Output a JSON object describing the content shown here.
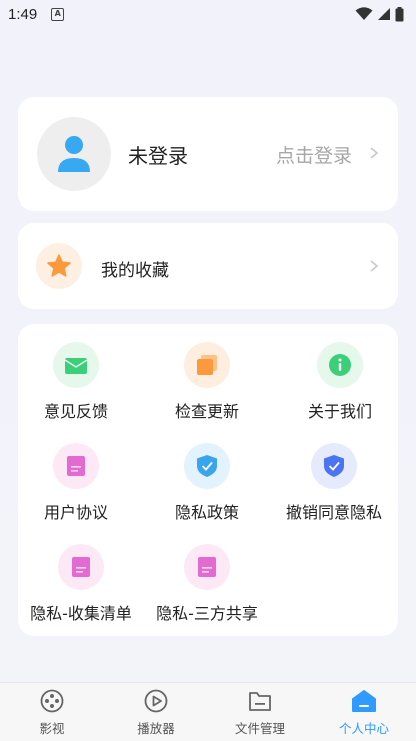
{
  "status_bar": {
    "time": "1:49",
    "notif_letter": "A"
  },
  "login": {
    "name": "未登录",
    "action": "点击登录"
  },
  "favorites": {
    "label": "我的收藏"
  },
  "menu": {
    "items": [
      {
        "label": "意见反馈",
        "icon": "mail-icon",
        "bg": "#e6f8ec",
        "color": "#3ccf79"
      },
      {
        "label": "检查更新",
        "icon": "layers-icon",
        "bg": "#fdeee0",
        "color": "#fb9a3c"
      },
      {
        "label": "关于我们",
        "icon": "info-icon",
        "bg": "#e6f8ec",
        "color": "#3ccf79"
      },
      {
        "label": "用户协议",
        "icon": "document-icon",
        "bg": "#fde8f6",
        "color": "#e36ad1"
      },
      {
        "label": "隐私政策",
        "icon": "shield-check-icon",
        "bg": "#e3f3fd",
        "color": "#3aa5ef"
      },
      {
        "label": "撤销同意隐私",
        "icon": "shield-check-icon",
        "bg": "#e5ebfd",
        "color": "#4c73f2"
      },
      {
        "label": "隐私-收集清单",
        "icon": "document-icon",
        "bg": "#fde8f6",
        "color": "#e36ad1"
      },
      {
        "label": "隐私-三方共享",
        "icon": "document-icon",
        "bg": "#fde8f6",
        "color": "#e36ad1"
      }
    ]
  },
  "nav": {
    "items": [
      {
        "label": "影视",
        "icon": "film-reel-icon"
      },
      {
        "label": "播放器",
        "icon": "play-icon"
      },
      {
        "label": "文件管理",
        "icon": "folder-icon"
      },
      {
        "label": "个人中心",
        "icon": "home-person-icon",
        "active": true
      }
    ],
    "active_color": "#2f9bff"
  }
}
